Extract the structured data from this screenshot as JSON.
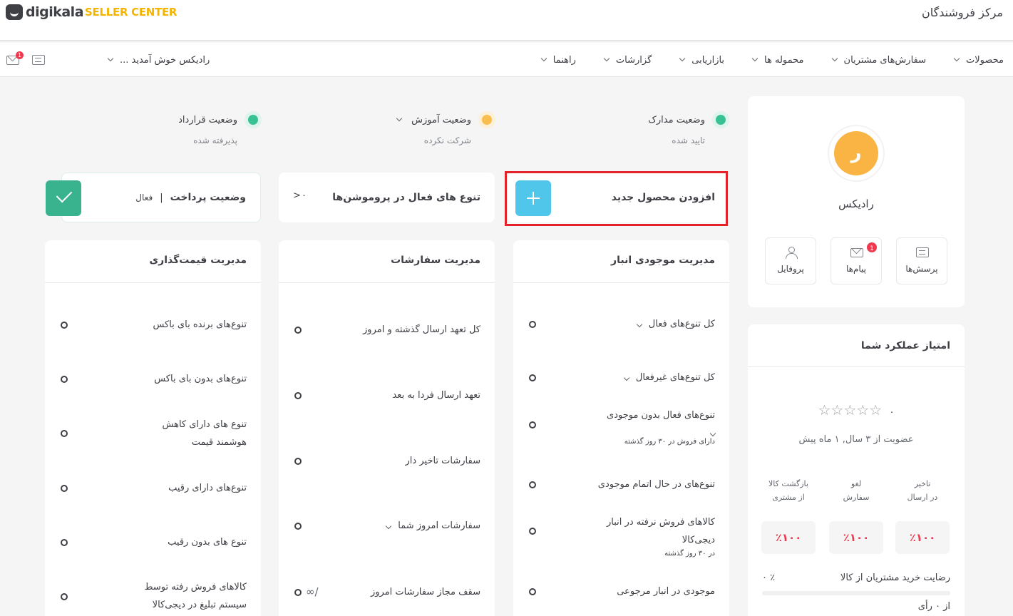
{
  "header": {
    "logo_word": "digikala",
    "logo_sub": "SELLER CENTER",
    "site_title": "مرکز فروشندگان"
  },
  "nav": {
    "items": [
      {
        "label": "محصولات"
      },
      {
        "label": "سفارش‌های مشتریان"
      },
      {
        "label": "محموله ها"
      },
      {
        "label": "بازاریابی"
      },
      {
        "label": "گزارشات"
      },
      {
        "label": "راهنما"
      }
    ],
    "welcome": "رادیکس خوش آمدید ...",
    "mail_badge": "1",
    "icons": [
      "mail-icon",
      "chat-icon",
      "chevron-down-icon"
    ]
  },
  "statuses": {
    "documents": {
      "title": "وضعیت مدارک",
      "value": "تایید شده",
      "color": "#38c193"
    },
    "training": {
      "title": "وضعیت آموزش",
      "value": "شرکت نکرده",
      "color": "#f9bd50"
    },
    "contract": {
      "title": "وضعیت قرارداد",
      "value": "پذیرفته شده",
      "color": "#38c193"
    }
  },
  "quick": {
    "add_product": "افزودن محصول جدید",
    "promotions": "تنوع های فعال در پروموشن‌ها",
    "promotions_count": "۰",
    "payment": "وضعیت پرداخت",
    "payment_sep": "|",
    "payment_value": "فعال"
  },
  "inventory": {
    "title": "مدیریت موجودی انبار",
    "rows": [
      {
        "label": "کل تنوع‌های فعال"
      },
      {
        "label": "کل تنوع‌های غیرفعال"
      },
      {
        "label": "تنوع‌های فعال بدون موجودی",
        "sub": "دارای فروش در ۳۰ روز گذشته"
      },
      {
        "label": "تنوع‌های در حال اتمام موجودی"
      },
      {
        "label": "کالاهای فروش نرفته در انبار دیجی‌کالا",
        "sub": "در ۳۰ روز گذشته"
      },
      {
        "label": "موجودی در انبار مرجوعی"
      }
    ]
  },
  "orders": {
    "title": "مدیریت سفارشات",
    "rows": [
      {
        "label": "کل تعهد ارسال گذشته و امروز"
      },
      {
        "label": "تعهد ارسال فردا به بعد"
      },
      {
        "label": "سفارشات تاخیر دار"
      },
      {
        "label": "سفارشات امروز شما"
      },
      {
        "label": "سقف مجاز سفارشات امروز",
        "value": "∞/"
      }
    ]
  },
  "pricing": {
    "title": "مدیریت قیمت‌گذاری",
    "rows": [
      {
        "label": "تنوع‌های برنده بای باکس"
      },
      {
        "label": "تنوع‌های بدون بای باکس"
      },
      {
        "label": "تنوع های دارای کاهش هوشمند قیمت"
      },
      {
        "label": "تنوع‌های دارای رقیب"
      },
      {
        "label": "تنوع های بدون رقیب"
      },
      {
        "label": "کالاهای فروش رفته توسط سیستم تبلیغ در دیجی‌کالا"
      }
    ]
  },
  "profile": {
    "initial": "ر",
    "name": "رادیکس",
    "tiles": [
      {
        "label": "پرسش‌ها",
        "icon": "chat-icon"
      },
      {
        "label": "پیام‌ها",
        "icon": "mail-icon",
        "badge": "1"
      },
      {
        "label": "پروفایل",
        "icon": "user-icon"
      }
    ]
  },
  "performance": {
    "title": "امتیاز عملکرد شما",
    "stars_value": "۰",
    "stars_count": 5,
    "membership": "عضویت از ۳ سال, ۱ ماه پیش",
    "metrics": [
      {
        "label1": "تاخیر",
        "label2": "در ارسال",
        "value": "٪۱۰۰"
      },
      {
        "label1": "لغو",
        "label2": "سفارش",
        "value": "٪۱۰۰"
      },
      {
        "label1": "بازگشت کالا",
        "label2": "از مشتری",
        "value": "٪۱۰۰"
      }
    ],
    "satisfaction_label": "رضایت خرید مشتریان از کالا",
    "satisfaction_value": "۰ ٪",
    "satisfaction_fraction": 0,
    "votes": "از ۰ رأی",
    "accent_color": "#ef394e"
  }
}
